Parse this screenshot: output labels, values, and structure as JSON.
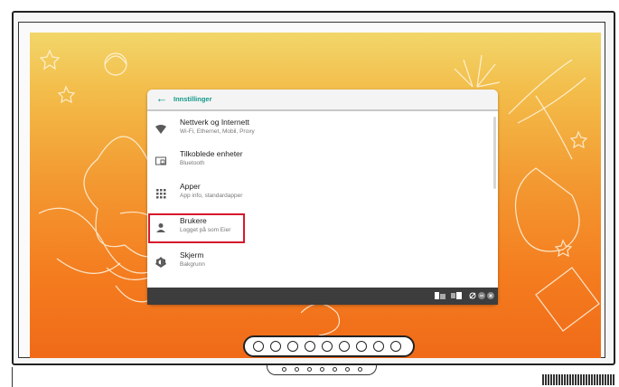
{
  "settings": {
    "header_title": "Innstillinger",
    "items": [
      {
        "title": "Nettverk og Internett",
        "subtitle": "Wi-Fi, Ethernet, Mobil, Proxy",
        "icon": "wifi-icon"
      },
      {
        "title": "Tilkoblede enheter",
        "subtitle": "Bluetooth",
        "icon": "connected-devices-icon"
      },
      {
        "title": "Apper",
        "subtitle": "App info, standardapper",
        "icon": "apps-grid-icon"
      },
      {
        "title": "Brukere",
        "subtitle": "Logget på som Eier",
        "icon": "user-icon"
      },
      {
        "title": "Skjerm",
        "subtitle": "Bakgrunn",
        "icon": "brightness-icon"
      }
    ]
  },
  "colors": {
    "accent": "#12998a",
    "highlight": "#d7192b",
    "taskbar": "#3d3d3d"
  }
}
